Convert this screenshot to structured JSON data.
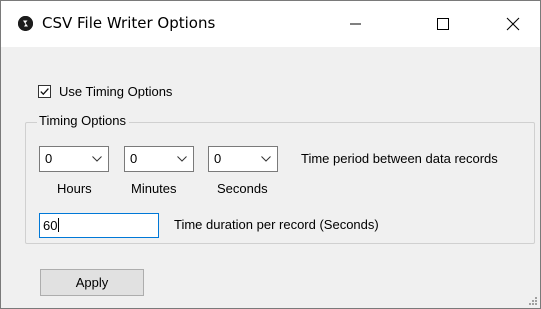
{
  "window": {
    "title": "CSV File Writer Options",
    "icon": "app-logo-icon"
  },
  "title_buttons": [
    "minimize-icon",
    "maximize-icon",
    "close-icon"
  ],
  "timing": {
    "use_timing_label": "Use Timing Options",
    "use_timing_checked": true,
    "group_label": "Timing Options",
    "hours_value": "0",
    "minutes_value": "0",
    "seconds_value": "0",
    "hours_label": "Hours",
    "minutes_label": "Minutes",
    "seconds_label": "Seconds",
    "period_label": "Time period between data records",
    "duration_value": "60",
    "duration_label": "Time duration per record (Seconds)"
  },
  "apply_label": "Apply",
  "colors": {
    "focus_border": "#0078d7",
    "button_face": "#e1e1e1",
    "dialog_background": "#f0f0f0"
  }
}
